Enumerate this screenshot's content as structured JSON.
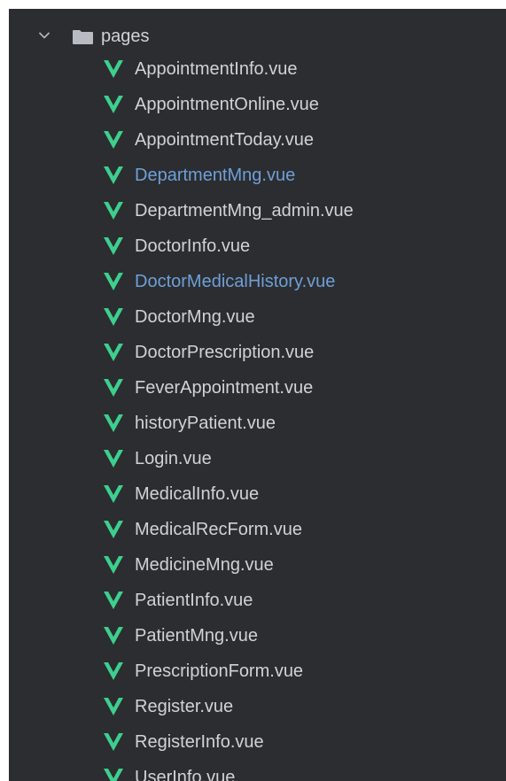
{
  "tree": {
    "folder": {
      "label": "pages",
      "icon": "folder-icon",
      "expanded": true,
      "chevron_icon": "chevron-down-icon"
    },
    "files": [
      {
        "label": "AppointmentInfo.vue",
        "modified": false,
        "icon": "vue-file-icon"
      },
      {
        "label": "AppointmentOnline.vue",
        "modified": false,
        "icon": "vue-file-icon"
      },
      {
        "label": "AppointmentToday.vue",
        "modified": false,
        "icon": "vue-file-icon"
      },
      {
        "label": "DepartmentMng.vue",
        "modified": true,
        "icon": "vue-file-icon"
      },
      {
        "label": "DepartmentMng_admin.vue",
        "modified": false,
        "icon": "vue-file-icon"
      },
      {
        "label": "DoctorInfo.vue",
        "modified": false,
        "icon": "vue-file-icon"
      },
      {
        "label": "DoctorMedicalHistory.vue",
        "modified": true,
        "icon": "vue-file-icon"
      },
      {
        "label": "DoctorMng.vue",
        "modified": false,
        "icon": "vue-file-icon"
      },
      {
        "label": "DoctorPrescription.vue",
        "modified": false,
        "icon": "vue-file-icon"
      },
      {
        "label": "FeverAppointment.vue",
        "modified": false,
        "icon": "vue-file-icon"
      },
      {
        "label": "historyPatient.vue",
        "modified": false,
        "icon": "vue-file-icon"
      },
      {
        "label": "Login.vue",
        "modified": false,
        "icon": "vue-file-icon"
      },
      {
        "label": "MedicalInfo.vue",
        "modified": false,
        "icon": "vue-file-icon"
      },
      {
        "label": "MedicalRecForm.vue",
        "modified": false,
        "icon": "vue-file-icon"
      },
      {
        "label": "MedicineMng.vue",
        "modified": false,
        "icon": "vue-file-icon"
      },
      {
        "label": "PatientInfo.vue",
        "modified": false,
        "icon": "vue-file-icon"
      },
      {
        "label": "PatientMng.vue",
        "modified": false,
        "icon": "vue-file-icon"
      },
      {
        "label": "PrescriptionForm.vue",
        "modified": false,
        "icon": "vue-file-icon"
      },
      {
        "label": "Register.vue",
        "modified": false,
        "icon": "vue-file-icon"
      },
      {
        "label": "RegisterInfo.vue",
        "modified": false,
        "icon": "vue-file-icon"
      },
      {
        "label": "UserInfo.vue",
        "modified": false,
        "icon": "vue-file-icon"
      }
    ]
  },
  "colors": {
    "panel_background": "#2b2d30",
    "text_default": "#cfd3d8",
    "text_modified": "#6f9fd8",
    "vue_icon": "#3ecf8e",
    "folder_icon": "#b8bcc2"
  }
}
